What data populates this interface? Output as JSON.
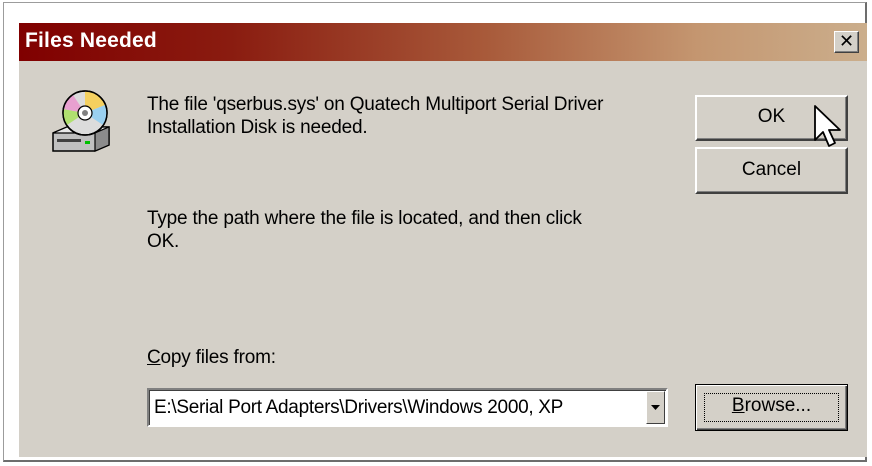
{
  "window": {
    "title": "Files Needed",
    "close_glyph": "✕"
  },
  "icon": {
    "name": "cd-drive-icon"
  },
  "message": {
    "line1": "The file 'qserbus.sys' on Quatech Multiport Serial Driver",
    "line2": "Installation Disk is needed.",
    "line3": "Type the path where the file is located, and then click",
    "line4": "OK."
  },
  "buttons": {
    "ok": "OK",
    "cancel": "Cancel",
    "browse_mnemonic": "B",
    "browse_rest": "rowse..."
  },
  "copy_from": {
    "label_mnemonic": "C",
    "label_rest": "opy files from:",
    "value": "E:\\Serial Port Adapters\\Drivers\\Windows 2000, XP"
  },
  "colors": {
    "titlebar_start": "#800000",
    "titlebar_end": "#cbae8c",
    "dialog_face": "#d4d0c8"
  }
}
